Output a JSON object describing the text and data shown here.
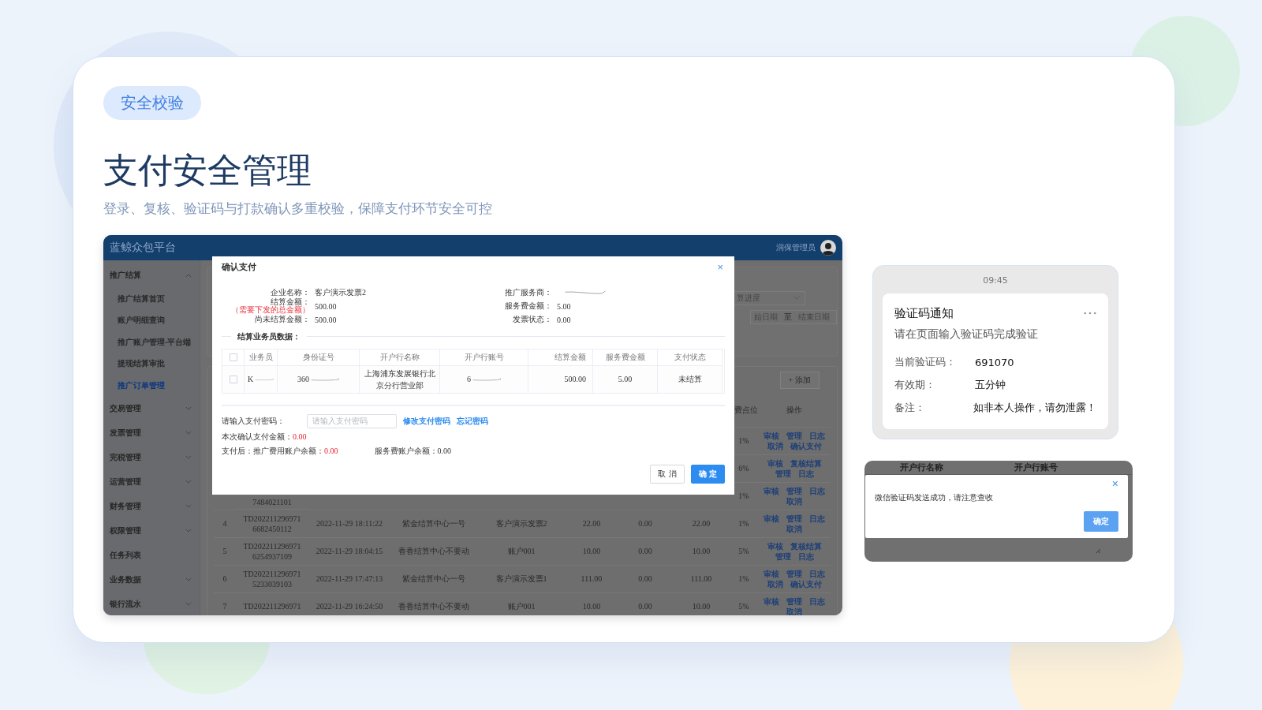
{
  "badge": "安全校验",
  "title": "支付安全管理",
  "subtitle": "登录、复核、验证码与打款确认多重校验，保障支付环节安全可控",
  "app": {
    "brand": "蓝鲸众包平台",
    "user_name": "润保管理员",
    "sidebar": [
      {
        "label": "推广结算",
        "kind": "group",
        "expanded": true,
        "children": [
          {
            "label": "推广结算首页",
            "selected": false
          },
          {
            "label": "账户明细查询",
            "selected": false
          },
          {
            "label": "推广账户管理-平台端",
            "selected": false
          },
          {
            "label": "提现结算审批",
            "selected": false
          },
          {
            "label": "推广订单管理",
            "selected": true
          }
        ]
      },
      {
        "label": "交易管理",
        "kind": "group",
        "expanded": false
      },
      {
        "label": "发票管理",
        "kind": "group",
        "expanded": false
      },
      {
        "label": "完税管理",
        "kind": "group",
        "expanded": false
      },
      {
        "label": "运营管理",
        "kind": "group",
        "expanded": false
      },
      {
        "label": "财务管理",
        "kind": "group",
        "expanded": false
      },
      {
        "label": "权限管理",
        "kind": "group",
        "expanded": false
      },
      {
        "label": "任务列表",
        "kind": "link"
      },
      {
        "label": "业务数据",
        "kind": "group",
        "expanded": false
      },
      {
        "label": "银行流水",
        "kind": "group",
        "expanded": false
      }
    ],
    "filters": {
      "select_value": "算进度",
      "date_start": "始日期",
      "date_separator": "至",
      "date_end": "结束日期"
    },
    "add_button": "+ 添加",
    "table": {
      "columns": [
        "费点位",
        "操作"
      ],
      "rows": [
        {
          "rate": "1%",
          "actions": [
            "审核",
            "管理",
            "日志",
            "取消",
            "确认支付"
          ]
        },
        {
          "rate": "6%",
          "actions": [
            "审核",
            "复核结算",
            "管理",
            "日志"
          ]
        },
        {
          "order_no": "7484021101",
          "rate": "1%",
          "actions": [
            "审核",
            "管理",
            "日志",
            "取消"
          ]
        },
        {
          "index": "4",
          "order_no": "TD202211296971 6682450112",
          "time": "2022-11-29 18:11:22",
          "center": "紫金结算中心一号",
          "company": "客户演示发票2",
          "amount": "22.00",
          "fee": "0.00",
          "total": "22.00",
          "rate": "1%",
          "actions": [
            "审核",
            "管理",
            "日志",
            "取消"
          ]
        },
        {
          "index": "5",
          "order_no": "TD202211296971 6254937109",
          "time": "2022-11-29 18:04:15",
          "center": "香香结算中心不要动",
          "company": "账户001",
          "amount": "10.00",
          "fee": "0.00",
          "total": "10.00",
          "rate": "5%",
          "actions": [
            "审核",
            "复核结算",
            "管理",
            "日志"
          ]
        },
        {
          "index": "6",
          "order_no": "TD202211296971 5233039103",
          "time": "2022-11-29 17:47:13",
          "center": "紫金结算中心一号",
          "company": "客户演示发票1",
          "amount": "111.00",
          "fee": "0.00",
          "total": "111.00",
          "rate": "1%",
          "actions": [
            "审核",
            "管理",
            "日志",
            "取消",
            "确认支付"
          ]
        },
        {
          "index": "7",
          "order_no": "TD202211296971",
          "time": "2022-11-29 16:24:50",
          "center": "香香结算中心不要动",
          "company": "账户001",
          "amount": "10.00",
          "fee": "0.00",
          "total": "10.00",
          "rate": "5%",
          "actions": [
            "审核",
            "管理",
            "日志",
            "取消"
          ]
        }
      ]
    },
    "modal": {
      "title": "确认支付",
      "close": "×",
      "fields_left": [
        {
          "label": "企业名称：",
          "value": "客户演示发票2",
          "redacted": false
        },
        {
          "label": "结算金额：",
          "note": "（需要下发的总金额）",
          "value": "500.00",
          "redacted": false
        },
        {
          "label": "尚未结算金额：",
          "value": "500.00",
          "redacted": false
        }
      ],
      "fields_right": [
        {
          "label": "推广服务商：",
          "redacted": true
        },
        {
          "label": "服务费金额：",
          "value": "5.00",
          "redacted": false
        },
        {
          "label": "发票状态：",
          "value": "0.00",
          "redacted": false
        }
      ],
      "section_title": "结算业务员数据：",
      "table": {
        "header_checked": false,
        "columns": [
          "业务员",
          "身份证号",
          "开户行名称",
          "开户行账号",
          "结算金额",
          "服务费金额",
          "支付状态"
        ],
        "rows": [
          {
            "checked": false,
            "cells": [
              {
                "text": "K",
                "redacted": true
              },
              {
                "text": "360",
                "redacted": true
              },
              {
                "text": "上海浦东发展银行北京分行营业部",
                "redacted": false
              },
              {
                "text": "6",
                "redacted": true
              },
              {
                "text": "500.00",
                "redacted": false
              },
              {
                "text": "5.00",
                "redacted": false
              },
              {
                "text": "未结算",
                "redacted": false
              }
            ]
          }
        ]
      },
      "password": {
        "label": "请输入支付密码：",
        "placeholder": "请输入支付密码",
        "links": [
          "修改支付密码",
          "忘记密码"
        ]
      },
      "summary": [
        {
          "parts": [
            {
              "label": "本次确认支付金额：",
              "value": "0.00",
              "highlight": true
            }
          ]
        },
        {
          "parts": [
            {
              "label": "支付后：推广费用账户余额：",
              "value": "0.00",
              "highlight": true
            },
            {
              "label": "服务费账户余额：",
              "value": "0.00",
              "highlight": false
            }
          ]
        }
      ],
      "buttons": [
        {
          "label": "取 消",
          "kind": "secondary"
        },
        {
          "label": "确 定",
          "kind": "primary"
        }
      ]
    }
  },
  "notification": {
    "time": "09:45",
    "title": "验证码通知",
    "message": "请在页面输入验证码完成验证",
    "rows": [
      {
        "label": "当前验证码：",
        "value": "691070"
      },
      {
        "label": "有效期：",
        "value": "五分钟"
      },
      {
        "label": "备注：",
        "value": "如非本人操作，请勿泄露！"
      }
    ]
  },
  "toast": {
    "background_columns": [
      "开户行名称",
      "开户行账号"
    ],
    "close": "×",
    "message": "微信验证码发送成功，请注意查收",
    "button": "确定"
  }
}
